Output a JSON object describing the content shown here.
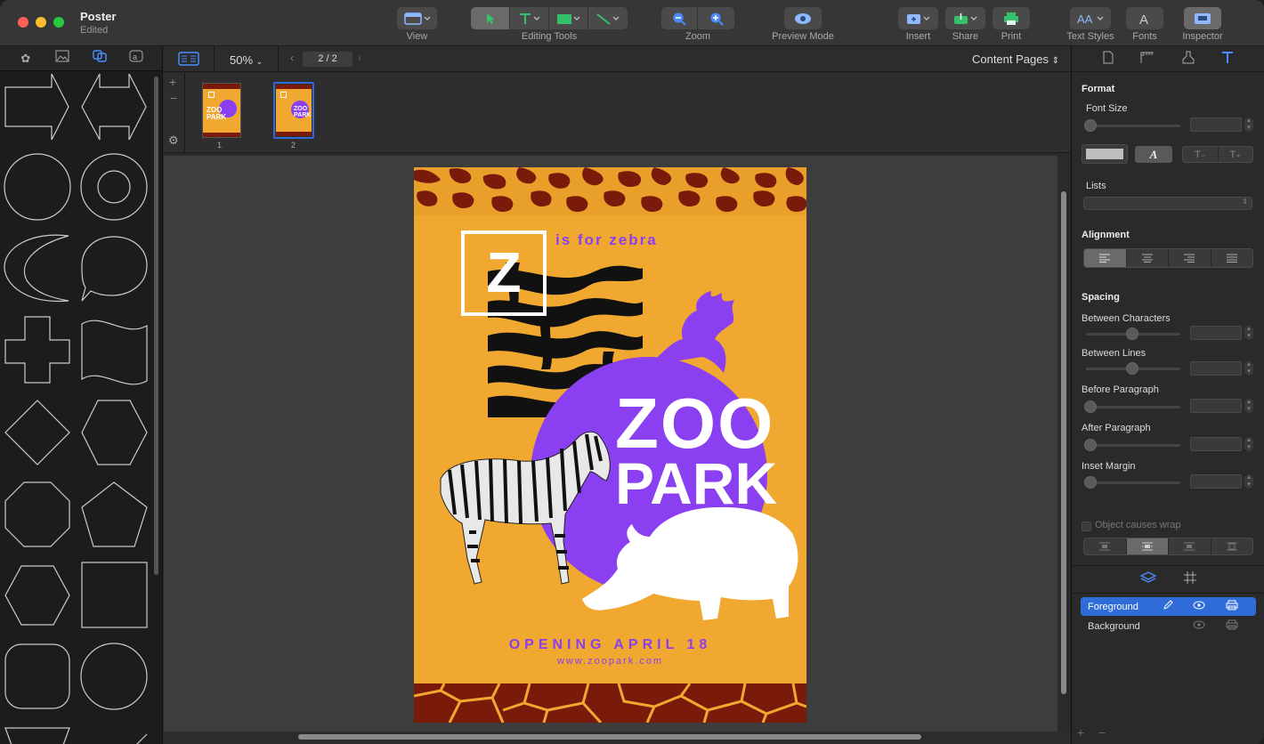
{
  "window": {
    "title": "Poster",
    "subtitle": "Edited"
  },
  "toolbar": {
    "view_label": "View",
    "editing_tools_label": "Editing Tools",
    "zoom_label": "Zoom",
    "preview_label": "Preview Mode",
    "insert_label": "Insert",
    "share_label": "Share",
    "print_label": "Print",
    "text_styles_label": "Text Styles",
    "fonts_label": "Fonts",
    "inspector_label": "Inspector"
  },
  "canvas_bar": {
    "zoom": "50%",
    "page_indicator": "2 / 2",
    "content_pages": "Content Pages"
  },
  "thumbnails": [
    {
      "number": "1"
    },
    {
      "number": "2"
    }
  ],
  "poster": {
    "letter": "Z",
    "tagline": "is for zebra",
    "title_line1": "ZOO",
    "title_line2": "PARK",
    "opening": "OPENING APRIL 18",
    "url": "www.zoopark.com"
  },
  "inspector": {
    "format_title": "Format",
    "font_size_label": "Font Size",
    "lists_label": "Lists",
    "alignment_title": "Alignment",
    "spacing_title": "Spacing",
    "between_chars_label": "Between Characters",
    "between_lines_label": "Between Lines",
    "before_paragraph_label": "Before Paragraph",
    "after_paragraph_label": "After Paragraph",
    "inset_margin_label": "Inset Margin",
    "object_wrap_label": "Object causes wrap"
  },
  "layers": [
    {
      "name": "Foreground",
      "selected": true
    },
    {
      "name": "Background",
      "selected": false
    }
  ],
  "colors": {
    "accent": "#2f6bd9",
    "poster_bg": "#f0a830",
    "purple": "#8a3ff0",
    "maroon": "#7a1a0a"
  }
}
